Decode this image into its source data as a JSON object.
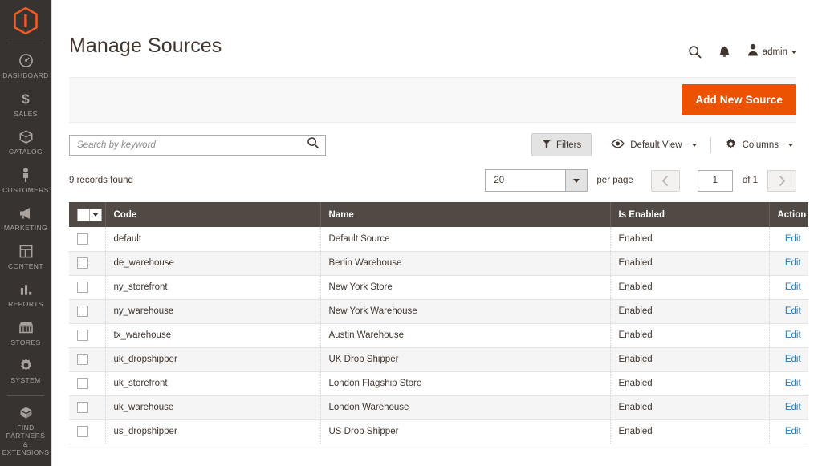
{
  "sidebar": {
    "logo": "magento-logo",
    "items": [
      {
        "icon": "dashboard-icon",
        "label": "DASHBOARD"
      },
      {
        "icon": "sales-dollar-icon",
        "label": "SALES"
      },
      {
        "icon": "catalog-box-icon",
        "label": "CATALOG"
      },
      {
        "icon": "customers-person-icon",
        "label": "CUSTOMERS"
      },
      {
        "icon": "marketing-megaphone-icon",
        "label": "MARKETING"
      },
      {
        "icon": "content-layout-icon",
        "label": "CONTENT"
      },
      {
        "icon": "reports-bars-icon",
        "label": "REPORTS"
      },
      {
        "icon": "stores-storefront-icon",
        "label": "STORES"
      },
      {
        "icon": "system-gear-icon",
        "label": "SYSTEM"
      }
    ],
    "partners": {
      "icon": "partners-cube-icon",
      "label": "FIND PARTNERS\n& EXTENSIONS",
      "line1": "FIND PARTNERS",
      "line2": "& EXTENSIONS"
    }
  },
  "header": {
    "title": "Manage Sources",
    "search_icon": "search-icon",
    "notifications_icon": "bell-icon",
    "user_icon": "user-avatar-icon",
    "user_name": "admin"
  },
  "page_actions": {
    "add_new_source_label": "Add New Source",
    "accent_color": "#eb5202"
  },
  "toolbar": {
    "search_placeholder": "Search by keyword",
    "search_value": "",
    "search_icon": "search-icon",
    "filters_label": "Filters",
    "filters_icon": "funnel-icon",
    "view_label": "Default View",
    "view_icon": "eye-icon",
    "columns_label": "Columns",
    "columns_icon": "gear-icon"
  },
  "records": {
    "found_text": "9 records found",
    "per_page_value": "20",
    "per_page_label": "per page",
    "page_value": "1",
    "of_label": "of 1",
    "prev_icon": "chevron-left-icon",
    "next_icon": "chevron-right-icon"
  },
  "table": {
    "columns": [
      "Code",
      "Name",
      "Is Enabled",
      "Action"
    ],
    "select_all_icon": "checkbox-dropdown-icon",
    "edit_label": "Edit",
    "edit_link_color": "#2d7bbb",
    "rows": [
      {
        "code": "default",
        "name": "Default Source",
        "is_enabled": "Enabled",
        "action": "Edit"
      },
      {
        "code": "de_warehouse",
        "name": "Berlin Warehouse",
        "is_enabled": "Enabled",
        "action": "Edit"
      },
      {
        "code": "ny_storefront",
        "name": "New York Store",
        "is_enabled": "Enabled",
        "action": "Edit"
      },
      {
        "code": "ny_warehouse",
        "name": "New York Warehouse",
        "is_enabled": "Enabled",
        "action": "Edit"
      },
      {
        "code": "tx_warehouse",
        "name": "Austin Warehouse",
        "is_enabled": "Enabled",
        "action": "Edit"
      },
      {
        "code": "uk_dropshipper",
        "name": "UK Drop Shipper",
        "is_enabled": "Enabled",
        "action": "Edit"
      },
      {
        "code": "uk_storefront",
        "name": "London Flagship Store",
        "is_enabled": "Enabled",
        "action": "Edit"
      },
      {
        "code": "uk_warehouse",
        "name": "London Warehouse",
        "is_enabled": "Enabled",
        "action": "Edit"
      },
      {
        "code": "us_dropshipper",
        "name": "US Drop Shipper",
        "is_enabled": "Enabled",
        "action": "Edit"
      }
    ]
  }
}
